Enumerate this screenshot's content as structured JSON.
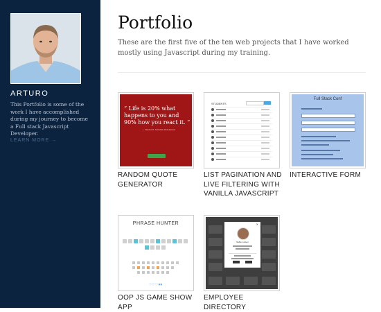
{
  "sidebar": {
    "name": "ARTURO",
    "description": "This Portfolio is some of the work I have accomplished during my journey to become a Full stack Javascript Developer.",
    "learn_more": "LEARN MORE →"
  },
  "main": {
    "title": "Portfolio",
    "intro": "These are the first five of the ten web projects that I have worked mostly using Javascript during my training."
  },
  "projects": [
    {
      "label": "RANDOM QUOTE GENERATOR",
      "thumb_quote": "“ Life is 20% what happens to you and 90% how you react it. ”",
      "thumb_cite": "— Charles R. Swindoll, Motivational"
    },
    {
      "label": "LIST PAGINATION AND LIVE FILTERING WITH VANILLA JAVASCRIPT",
      "thumb_title": "STUDENTS"
    },
    {
      "label": "INTERACTIVE FORM",
      "thumb_title": "Full Stack Conf"
    },
    {
      "label": "OOP JS GAME SHOW APP",
      "thumb_title": "PHRASE HUNTER",
      "thumb_hearts": "♡♡♡♥♥"
    },
    {
      "label": "EMPLOYEE DIRECTORY",
      "thumb_name": "Sable Larsen"
    }
  ],
  "colors": {
    "sidebar_bg": "#0c2340",
    "quote_bg": "#a01515",
    "form_bg": "#a8c4ea",
    "accent_blue": "#5cc0de"
  }
}
